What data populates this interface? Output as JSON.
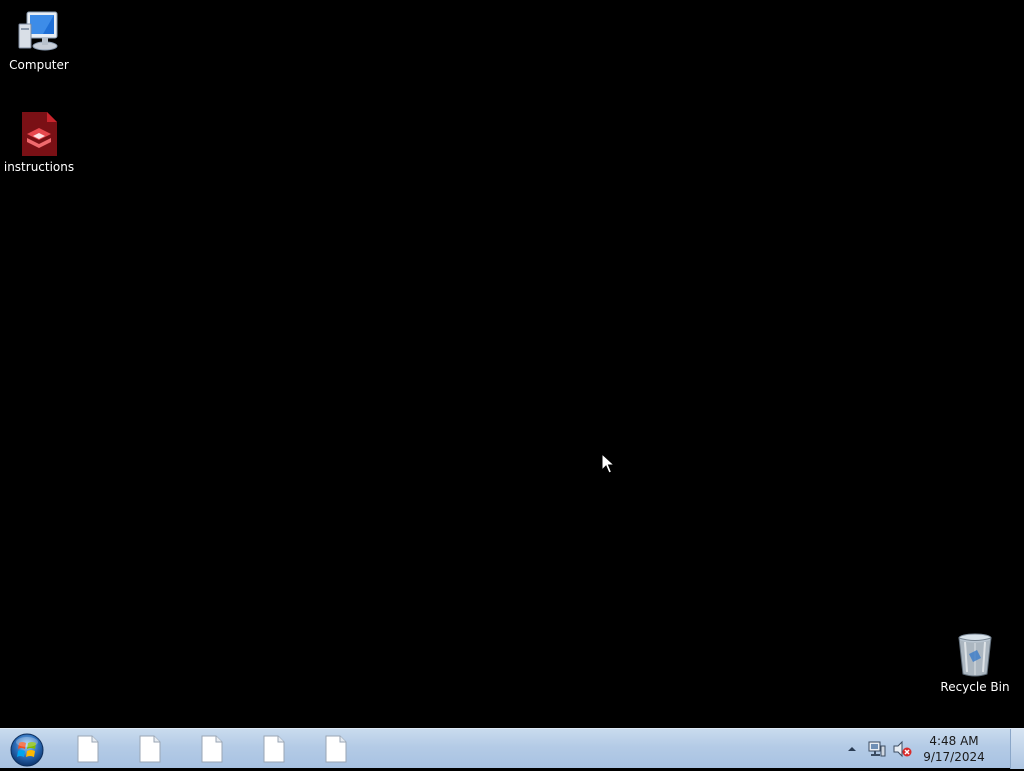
{
  "desktop": {
    "icons": [
      {
        "label": "Computer",
        "icon": "computer-icon"
      },
      {
        "label": "instructions",
        "icon": "pdf-document-icon"
      },
      {
        "label": "Recycle Bin",
        "icon": "recycle-bin-icon"
      }
    ]
  },
  "taskbar": {
    "start_icon": "windows-start-orb-icon",
    "tasks": [
      {
        "icon": "blank-document-icon"
      },
      {
        "icon": "blank-document-icon"
      },
      {
        "icon": "blank-document-icon"
      },
      {
        "icon": "blank-document-icon"
      },
      {
        "icon": "blank-document-icon"
      }
    ],
    "tray": {
      "icons": [
        "show-hidden-icons-arrow-icon",
        "network-icon",
        "volume-muted-icon"
      ],
      "time": "4:48 AM",
      "date": "9/17/2024"
    }
  },
  "colors": {
    "desktop_background": "#000000",
    "taskbar_top": "#c9dbee",
    "taskbar_bottom": "#a8c2e2",
    "pdf_red": "#c8242c"
  }
}
